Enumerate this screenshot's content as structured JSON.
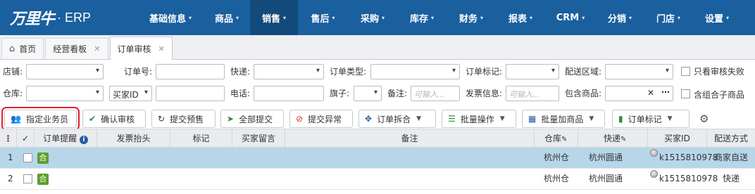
{
  "app": {
    "logo_text": "万里牛",
    "erp_text": "· ERP"
  },
  "nav": [
    {
      "label": "基础信息"
    },
    {
      "label": "商品"
    },
    {
      "label": "销售"
    },
    {
      "label": "售后"
    },
    {
      "label": "采购"
    },
    {
      "label": "库存"
    },
    {
      "label": "财务"
    },
    {
      "label": "报表"
    },
    {
      "label": "CRM"
    },
    {
      "label": "分销"
    },
    {
      "label": "门店"
    },
    {
      "label": "设置"
    }
  ],
  "tabs": [
    {
      "label": "首页"
    },
    {
      "label": "经营看板"
    },
    {
      "label": "订单审核"
    }
  ],
  "filters": {
    "shop": "店铺:",
    "order_no": "订单号:",
    "express": "快递:",
    "order_type": "订单类型:",
    "order_mark": "订单标记:",
    "delivery_area": "配送区域:",
    "only_failed": "只看审核失败",
    "warehouse": "仓库:",
    "buyer_field": "买家ID",
    "phone": "电话:",
    "flag": "旗子:",
    "remark": "备注:",
    "remark_ph": "可输入...",
    "invoice": "发票信息:",
    "invoice_ph": "可输入...",
    "contains_goods": "包含商品:",
    "include_combo": "含组合子商品"
  },
  "toolbar": {
    "assign": "指定业务员",
    "confirm": "确认审核",
    "submit_presale": "提交预售",
    "submit_all": "全部提交",
    "submit_exception": "提交异常",
    "split_merge": "订单拆合",
    "batch": "批量操作",
    "batch_add": "批量加商品",
    "order_mark": "订单标记"
  },
  "table": {
    "headers": {
      "reminder": "订单提醒",
      "invoice_title": "发票抬头",
      "mark": "标记",
      "buyer_msg": "买家留言",
      "remark": "备注",
      "warehouse": "仓库",
      "express": "快递",
      "buyer_id": "买家ID",
      "delivery": "配送方式"
    },
    "rows": [
      {
        "no": "1",
        "tag": "合",
        "warehouse": "杭州仓",
        "express": "杭州圆通",
        "buyer_id": "k1515810978",
        "delivery": "商家自送"
      },
      {
        "no": "2",
        "tag": "合",
        "warehouse": "杭州仓",
        "express": "杭州圆通",
        "buyer_id": "k1515810978",
        "delivery": "快递"
      }
    ]
  },
  "colors": {
    "nav_bg": "#1a5f9e",
    "nav_active": "#124a7c",
    "selected_row": "#b7d6ea",
    "tag_green": "#5e9e2b",
    "highlight": "#e0202a"
  }
}
